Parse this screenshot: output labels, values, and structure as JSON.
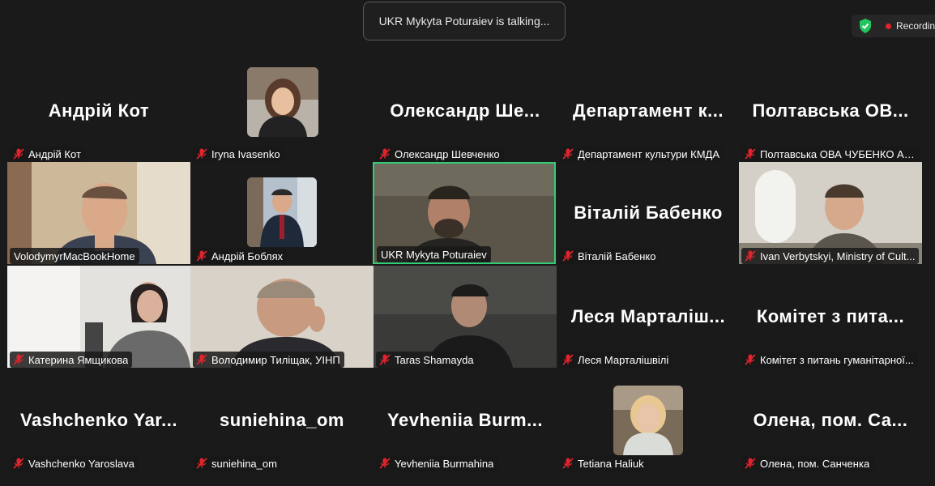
{
  "banner": {
    "talking_text": "UKR Mykyta Poturaiev is talking..."
  },
  "recording": {
    "label": "Recording"
  },
  "tiles": [
    {
      "big": "Андрій Кот",
      "label": "Андрій Кот",
      "muted": true
    },
    {
      "big": "",
      "label": "Iryna Ivasenko",
      "muted": true
    },
    {
      "big": "Олександр Ше...",
      "label": "Олександр Шевченко",
      "muted": true
    },
    {
      "big": "Департамент к...",
      "label": "Департамент культури КМДА",
      "muted": true
    },
    {
      "big": "Полтавська ОВ...",
      "label": "Полтавська ОВА ЧУБЕНКО АН...",
      "muted": true
    },
    {
      "big": "",
      "label": "VolodymyrMacBookHome",
      "muted": false
    },
    {
      "big": "",
      "label": "Андрій Боблях",
      "muted": true
    },
    {
      "big": "",
      "label": "UKR Mykyta Poturaiev",
      "muted": false
    },
    {
      "big": "Віталій Бабенко",
      "label": "Віталій Бабенко",
      "muted": true
    },
    {
      "big": "",
      "label": "Ivan Verbytskyi, Ministry of Cult...",
      "muted": true
    },
    {
      "big": "",
      "label": "Катерина Ямщикова",
      "muted": true
    },
    {
      "big": "",
      "label": "Володимир Тиліщак, УІНП",
      "muted": true
    },
    {
      "big": "",
      "label": "Taras Shamayda",
      "muted": true
    },
    {
      "big": "Леся Марталіш...",
      "label": "Леся Марталішвілі",
      "muted": true
    },
    {
      "big": "Комітет з пита...",
      "label": "Комітет з питань гуманітарної...",
      "muted": true
    },
    {
      "big": "Vashchenko Yar...",
      "label": "Vashchenko Yaroslava",
      "muted": true
    },
    {
      "big": "suniehina_om",
      "label": "suniehina_om",
      "muted": true
    },
    {
      "big": "Yevheniia Burm...",
      "label": "Yevheniia Burmahina",
      "muted": true
    },
    {
      "big": "",
      "label": "Tetiana Haliuk",
      "muted": true
    },
    {
      "big": "Олена, пом. Са...",
      "label": "Олена, пом. Санченка",
      "muted": true
    }
  ],
  "colors": {
    "background": "#1a1a1a",
    "active_border": "#33cc77",
    "mute_red": "#e0242b",
    "shield_green": "#22c55e"
  }
}
